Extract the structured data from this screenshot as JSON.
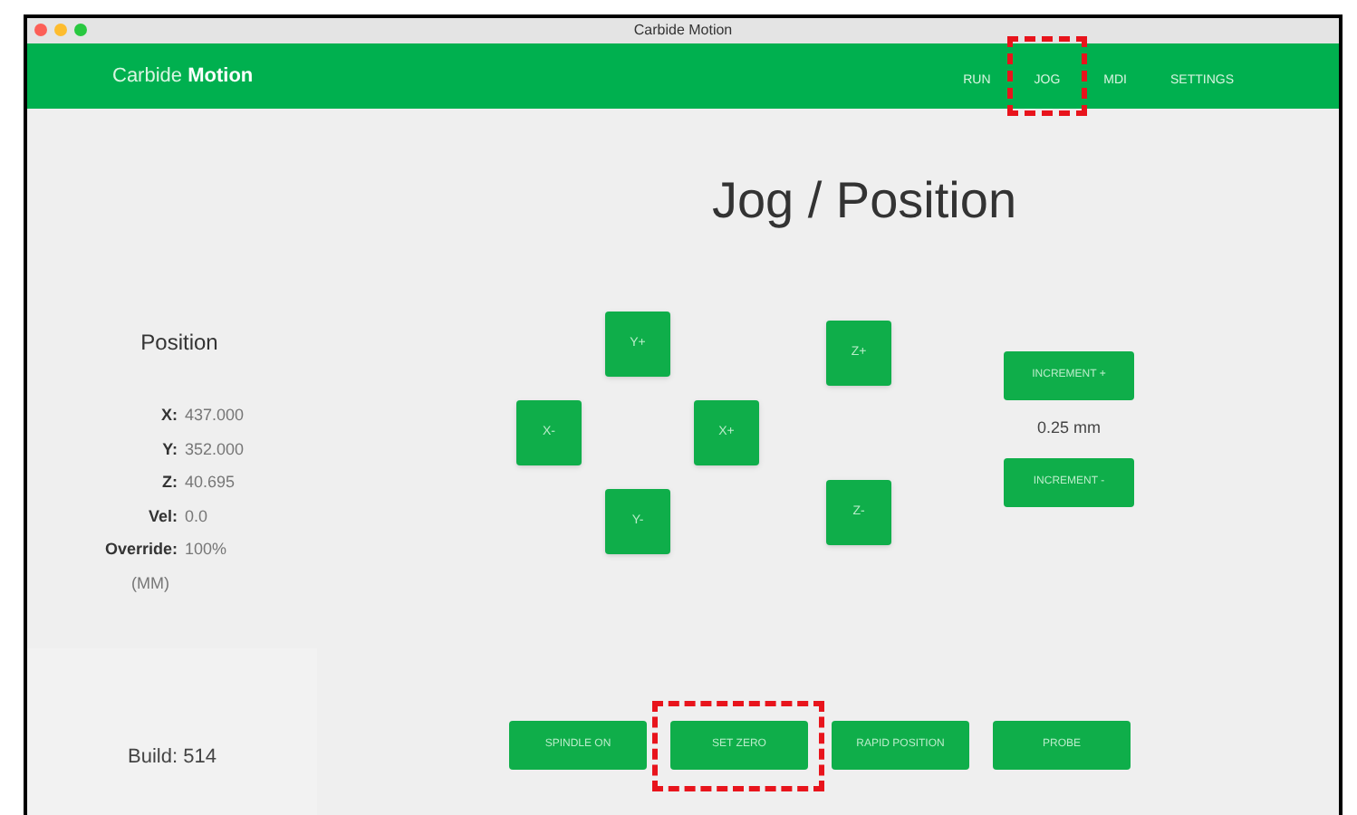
{
  "window": {
    "title": "Carbide Motion"
  },
  "header": {
    "brand_light": "Carbide",
    "brand_bold": "Motion",
    "nav": [
      {
        "label": "RUN",
        "highlighted": false
      },
      {
        "label": "JOG",
        "highlighted": true
      },
      {
        "label": "MDI",
        "highlighted": false
      },
      {
        "label": "SETTINGS",
        "highlighted": false
      }
    ]
  },
  "position": {
    "title": "Position",
    "rows": [
      {
        "label": "X:",
        "value": "437.000"
      },
      {
        "label": "Y:",
        "value": "352.000"
      },
      {
        "label": "Z:",
        "value": "40.695"
      },
      {
        "label": "Vel:",
        "value": "0.0"
      },
      {
        "label": "Override:",
        "value": "100%"
      }
    ],
    "units": "(MM)"
  },
  "build": "Build: 514",
  "page_title": "Jog / Position",
  "jog": {
    "y_plus": "Y+",
    "x_minus": "X-",
    "x_plus": "X+",
    "y_minus": "Y-",
    "z_plus": "Z+",
    "z_minus": "Z-"
  },
  "increment": {
    "plus": "INCREMENT +",
    "value": "0.25 mm",
    "minus": "INCREMENT -"
  },
  "actions": [
    {
      "label": "SPINDLE ON",
      "highlighted": false
    },
    {
      "label": "SET ZERO",
      "highlighted": true
    },
    {
      "label": "RAPID POSITION",
      "highlighted": false
    },
    {
      "label": "PROBE",
      "highlighted": false
    }
  ]
}
